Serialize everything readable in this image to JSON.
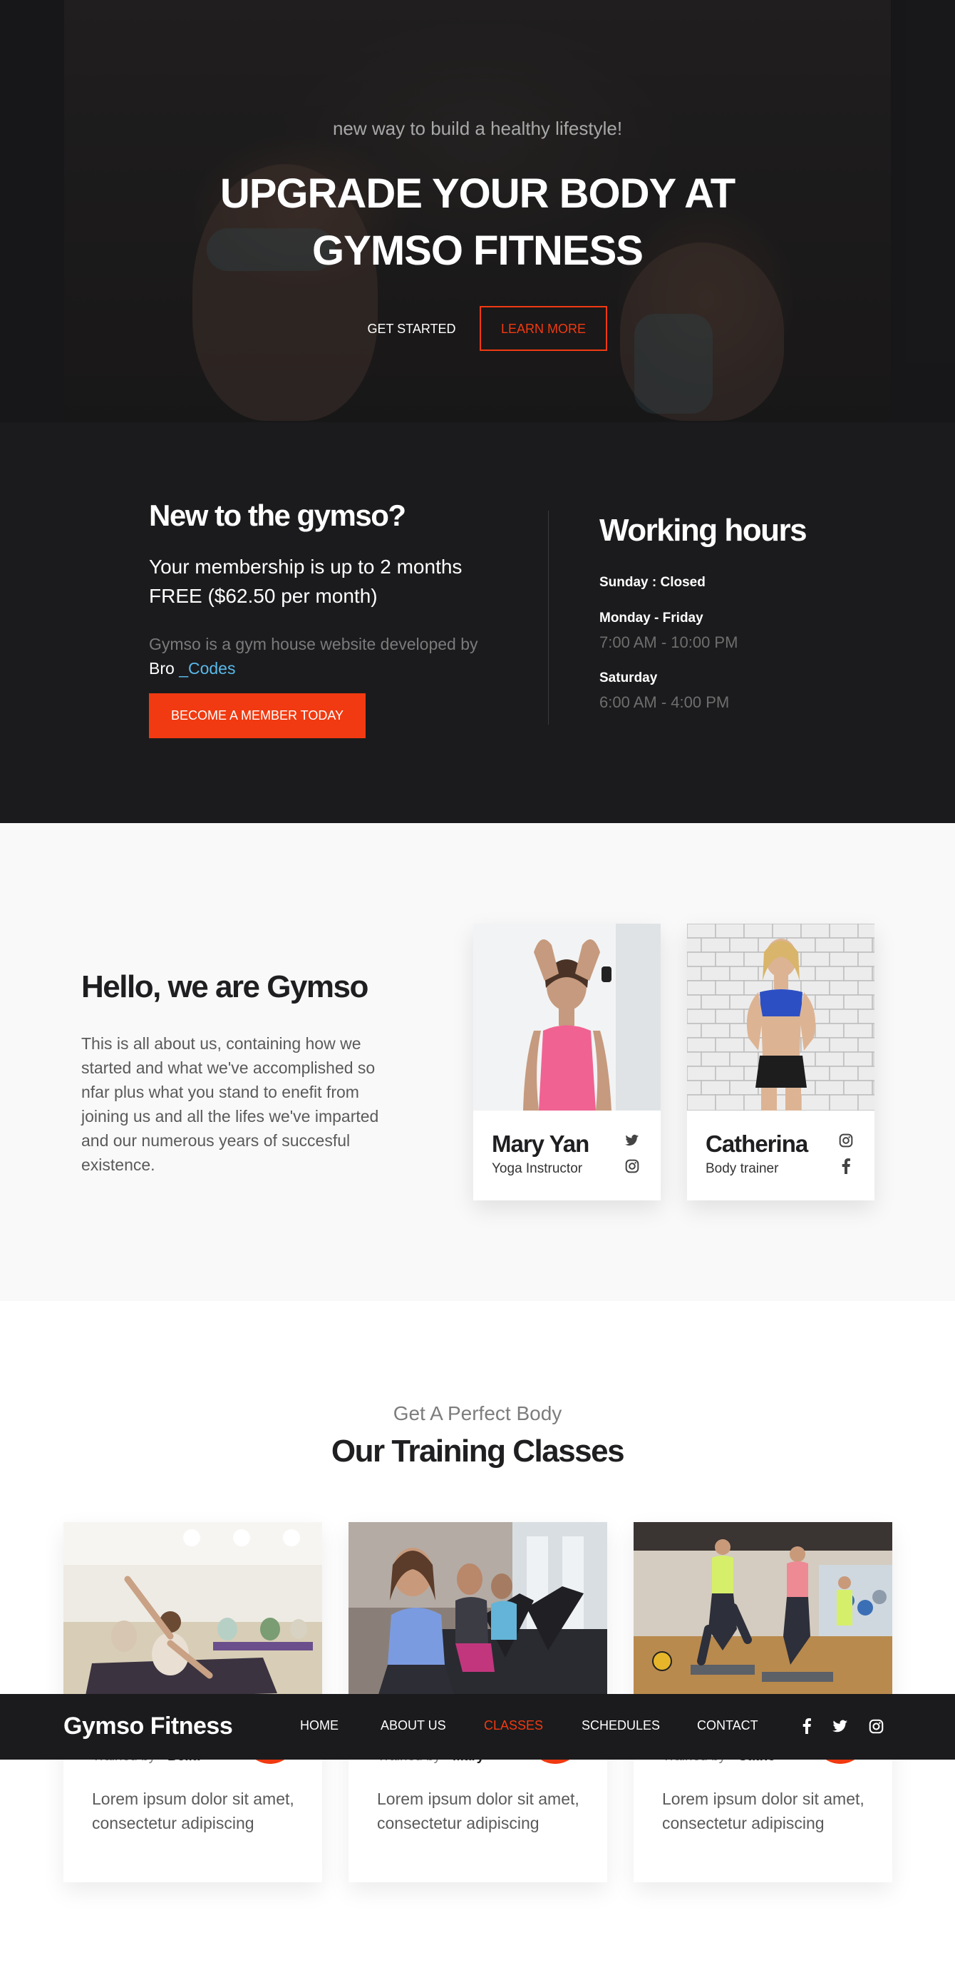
{
  "hero": {
    "tagline": "new way to build a healthy lifestyle!",
    "title": "UPGRADE YOUR BODY AT GYMSO FITNESS",
    "get_started": "GET STARTED",
    "learn_more": "LEARN MORE"
  },
  "membership": {
    "title": "New to the gymso?",
    "offer": "Your membership is up to 2 months FREE ($62.50 per month)",
    "credit_text": "Gymso is a gym house website developed by",
    "credit_by": "Bro",
    "credit_codes": "_Codes",
    "cta": "BECOME A MEMBER TODAY"
  },
  "hours": {
    "title": "Working hours",
    "sunday": "Sunday : Closed",
    "weekday_label": "Monday - Friday",
    "weekday_time": "7:00 AM - 10:00 PM",
    "saturday_label": "Saturday",
    "saturday_time": "6:00 AM - 4:00 PM"
  },
  "about": {
    "title": "Hello, we are Gymso",
    "text": "This is all about us, containing how we started and what we've accomplished so nfar plus what you stand to enefit from joining us and all the lifes we've imparted and our numerous years of succesful existence.",
    "team": [
      {
        "name": "Mary Yan",
        "role": "Yoga Instructor",
        "icons": [
          "twitter-icon",
          "instagram-icon"
        ]
      },
      {
        "name": "Catherina",
        "role": "Body trainer",
        "icons": [
          "instagram-icon",
          "facebook-icon"
        ]
      }
    ]
  },
  "classes": {
    "subtitle": "Get A Perfect Body",
    "title": "Our Training Classes",
    "items": [
      {
        "trainer_prefix": "Trained by",
        "trainer": "Bella",
        "desc": "Lorem ipsum dolor sit amet, consectetur adipiscing"
      },
      {
        "trainer_prefix": "Trained by",
        "trainer": "Mary",
        "desc": "Lorem ipsum dolor sit amet, consectetur adipiscing"
      },
      {
        "trainer_prefix": "Trained by",
        "trainer": "Cathe",
        "desc": "Lorem ipsum dolor sit amet, consectetur adipiscing"
      }
    ]
  },
  "nav": {
    "brand": "Gymso Fitness",
    "items": [
      "HOME",
      "ABOUT US",
      "CLASSES",
      "SCHEDULES",
      "CONTACT"
    ],
    "active": "CLASSES",
    "social": [
      "facebook-icon",
      "twitter-icon",
      "instagram-icon"
    ]
  },
  "colors": {
    "accent": "#f13a11",
    "dark": "#1b1b1d",
    "link": "#5ab9ea"
  }
}
